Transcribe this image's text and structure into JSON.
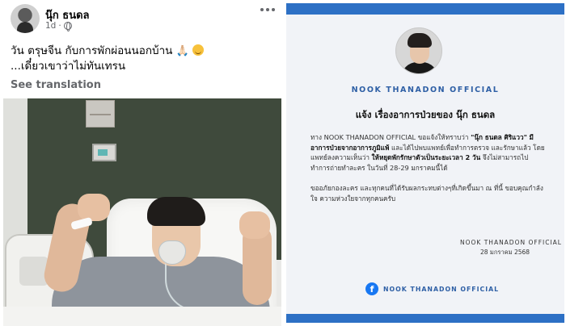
{
  "post": {
    "author": "นุ๊ก ธนดล",
    "time": "1d",
    "separator": "·",
    "text_line1": "วัน ตรุษจีน กับการพักผ่อนนอกบ้าน",
    "text_line2": "...เดี๋ยวเขาว่าไม่ทันเทรน",
    "pray_emoji": "🙏🏻",
    "translate_label": "See translation",
    "icons": [
      "avatar",
      "globe-icon",
      "more-options-icon",
      "praying-hands-emoji",
      "smile-emoji"
    ]
  },
  "card": {
    "brand": "NOOK THANADON OFFICIAL",
    "heading": "แจ้ง เรื่องอาการป่วยของ นุ๊ก ธนดล",
    "p1_a": "ทาง NOOK THANADON OFFICIAL ขอแจ้งให้ทราบว่า ",
    "p1_b": "\"นุ๊ก ธนดล ศิริแวว\"",
    "p1_c": "มีอาการป่วยจากอาการภูมิแพ้",
    "p1_d": " และได้ไปพบแพทย์เพื่อทำการตรวจ และรักษาแล้ว โดยแพทย์ลงความเห็นว่า ",
    "p1_e": "ให้หยุดพักรักษาตัวเป็นระยะเวลา 2 วัน",
    "p1_f": " จึงไม่สามารถไปทำการถ่ายทำละคร ในวันที่ 28-29 มกราคมนี้ได้",
    "p2": "ขออภัยกองละคร และทุกคนที่ได้รับผลกระทบต่างๆที่เกิดขึ้นมา ณ ที่นี้ ขอบคุณกำลังใจ ความห่วงใยจากทุกคนครับ",
    "signature": "NOOK THANADON OFFICIAL",
    "date": "28 มกราคม 2568",
    "fb_label": "NOOK THANADON OFFICIAL",
    "fb_letter": "f"
  },
  "colors": {
    "accent_blue": "#2d70c5",
    "facebook_blue": "#1877f2",
    "card_bg": "#f1f3f7"
  }
}
